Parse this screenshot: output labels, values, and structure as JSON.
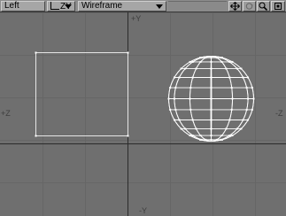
{
  "toolbar": {
    "view_mode": "Left",
    "axis_mode": "ZY",
    "render_mode": "Wireframe",
    "buttons": [
      {
        "name": "move-view-icon"
      },
      {
        "name": "rotate-view-icon"
      },
      {
        "name": "zoom-view-icon"
      },
      {
        "name": "maximize-view-icon"
      }
    ]
  },
  "viewport": {
    "axis_labels": {
      "top": "+Y",
      "bottom": "-Y",
      "left": "+Z",
      "right": "-Z"
    }
  },
  "colors": {
    "background": "#6f6f6f",
    "grid": "#666666",
    "axis": "#2b2b2b",
    "wire": "#ffffff"
  }
}
